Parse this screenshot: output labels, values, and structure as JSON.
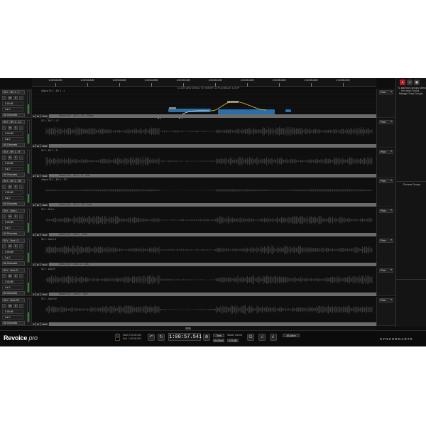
{
  "ruler": {
    "ticks": [
      "1:00:54.200",
      "1:00:54.400",
      "1:00:54.600",
      "1:00:54.800",
      "1:00:55.000",
      "1:00:55.200",
      "1:00:55.400",
      "1:00:55.600",
      "1:00:55.800",
      "1:00:56.000"
    ],
    "hint": "CLICK AND DRAG TO INSERT A PLAYBACK LOOP"
  },
  "tracks": [
    {
      "name": "SLY - BV 1 - L",
      "volume": "0.00 dB",
      "pan": "0 ▸ 0",
      "channels": "All Channels",
      "lane_label": "Adjust SLY - BV 1 - L",
      "process_title": "Match SLY - BV 1 - R1 - Guide",
      "pitch": "Pitch"
    },
    {
      "name": "SLY - BV 1 - L2",
      "volume": "0.00 dB",
      "pan": "0 ▸ 0",
      "channels": "All Channels",
      "lane_label": "SLY - BV 1 - L2",
      "process_title": "",
      "pitch": "Pitch"
    },
    {
      "name": "SLY - BV 1 - R",
      "volume": "0.00 dB",
      "pan": "0 ▸ 0",
      "channels": "All Channels",
      "lane_label": "SLY - BV 1 - R",
      "process_title": "Match SLY - BV 1 - R - Dub",
      "pitch": "Pitch"
    },
    {
      "name": "SLY - BV 1 - R2",
      "volume": "0.00 dB",
      "pan": "0 ▸ 0",
      "channels": "All Channels",
      "lane_label": "Adjust SLY - BV 1 - R2",
      "process_title": "Match SLY - BV 1 - R2 - Dub",
      "pitch": "Pitch"
    },
    {
      "name": "SLY - Dub L",
      "volume": "0.00 dB",
      "pan": "0 ▸ 0",
      "channels": "All Channels",
      "lane_label": "SLY - Dub L",
      "process_title": "Match SLY - Dub L - Dub",
      "pitch": "Pitch"
    },
    {
      "name": "SLY - Dub L2",
      "volume": "0.00 dB",
      "pan": "0 ▸ 0",
      "channels": "All Channels",
      "lane_label": "SLY - Dub L2",
      "process_title": "Match SLY - Dub L2 - Dub",
      "pitch": "Pitch"
    },
    {
      "name": "SLY - Dub R",
      "volume": "0.00 dB",
      "pan": "0 ▸ 0",
      "channels": "All Channels",
      "lane_label": "SLY - Dub R",
      "process_title": "Match SLY - Dub R - Dub",
      "pitch": "Pitch"
    },
    {
      "name": "SLY - Dub R2",
      "volume": "0.00 dB",
      "pan": "0 ▸ 0",
      "channels": "All Channels",
      "lane_label": "SLY - Dub R2",
      "process_title": "",
      "pitch": "Pitch"
    }
  ],
  "process_buttons": {
    "new": "New"
  },
  "track_buttons": {
    "mute": "M",
    "solo": "S",
    "rec": "R",
    "in": "I"
  },
  "right_panel": {
    "help": "To add track groups select the menu Tracks → Manage Track Groups...",
    "process_groups": "Process Groups"
  },
  "transport": {
    "beat": "8",
    "start_label": "Start",
    "start_value": "0:00:00.000",
    "end_label": "End",
    "end_value": "1:00:00.000",
    "time": "1:00:57.541",
    "view_mode": "Time",
    "no_scroll": "No Scroll",
    "master_volume_label": "Master Volume",
    "master_volume_value": "0.00 dB",
    "all_active": "All Active"
  },
  "brand": {
    "name": "Revoice",
    "suffix": "pro",
    "company": "SYNCHROARTS"
  },
  "colors": {
    "accent_blue": "#2f7fc4",
    "pitch_line": "#e8c63a",
    "match_green": "#43d06a",
    "background": "#0e0e0e"
  }
}
